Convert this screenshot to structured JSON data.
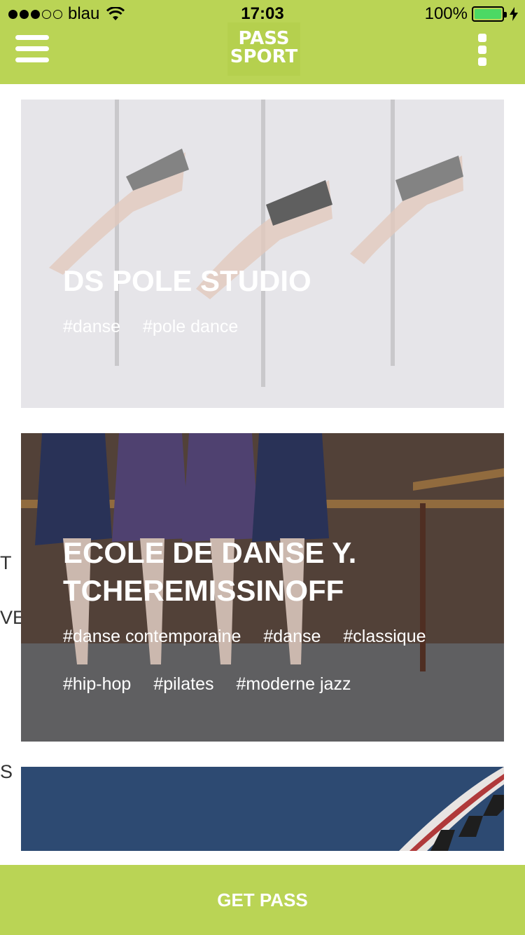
{
  "status_bar": {
    "carrier": "blau",
    "time": "17:03",
    "battery": "100%"
  },
  "header": {
    "logo_line1": "PASS",
    "logo_line2": "SPORT",
    "menu_icon": "hamburger-icon",
    "more_icon": "more-vertical-icon"
  },
  "colors": {
    "brand": "#bad455"
  },
  "side_letters": [
    "T",
    "VE",
    "S"
  ],
  "cards": [
    {
      "title": "DS POLE STUDIO",
      "tags": [
        "#danse",
        "#pole dance"
      ]
    },
    {
      "title": "ECOLE DE DANSE Y. TCHEREMISSINOFF",
      "tags": [
        "#danse contemporaine",
        "#danse",
        "#classique",
        "#hip-hop",
        "#pilates",
        "#moderne jazz"
      ]
    }
  ],
  "footer": {
    "button_label": "GET PASS"
  }
}
